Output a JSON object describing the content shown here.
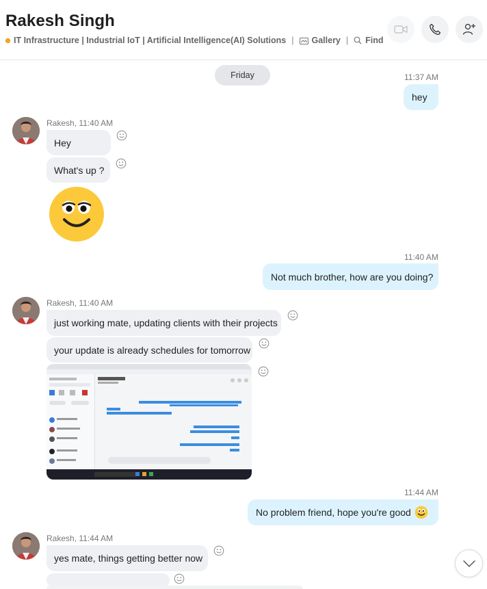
{
  "header": {
    "title": "Rakesh Singh",
    "subtitle": "IT Infrastructure | Industrial IoT | Artificial Intelligence(AI) Solutions",
    "gallery_label": "Gallery",
    "find_label": "Find",
    "separator": "|",
    "status_color": "#f5a623",
    "buttons": [
      "video-call-icon",
      "audio-call-icon",
      "add-person-icon"
    ]
  },
  "conversation": {
    "day_label": "Friday",
    "messages": [
      {
        "direction": "out",
        "time": "11:37 AM",
        "text": "hey"
      },
      {
        "direction": "in",
        "sender_line": "Rakesh, 11:40 AM",
        "texts": [
          "Hey",
          "What's up ?"
        ],
        "sticker": "smiley-emoticon"
      },
      {
        "direction": "out",
        "time": "11:40 AM",
        "text": "Not much brother, how are you doing?"
      },
      {
        "direction": "in",
        "sender_line": "Rakesh, 11:40 AM",
        "texts": [
          "just working mate, updating clients with their projects",
          "your update is already schedules for tomorrow"
        ],
        "attachment": "screenshot-image"
      },
      {
        "direction": "out",
        "time": "11:44 AM",
        "text": "No problem friend, hope you're good",
        "emoji": "smiley-emoji"
      },
      {
        "direction": "in",
        "sender_line": "Rakesh, 11:44 AM",
        "texts": [
          "yes mate, things getting better now"
        ]
      }
    ]
  },
  "colors": {
    "outgoing_bubble": "#dcf3fd",
    "incoming_bubble": "#eef0f3",
    "day_pill": "#e4e6ea"
  }
}
